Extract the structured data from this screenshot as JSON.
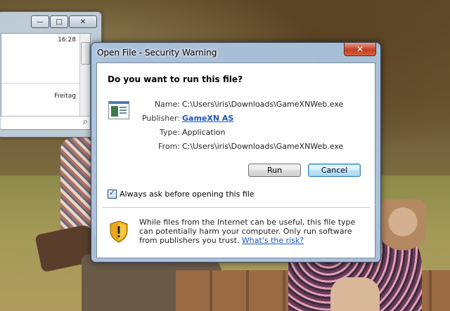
{
  "background_window": {
    "controls": [
      "—",
      "□",
      "✕"
    ],
    "rows": [
      {
        "time": "16:28"
      },
      {
        "time": "Freitag"
      }
    ]
  },
  "dialog": {
    "title": "Open File - Security Warning",
    "question": "Do you want to run this file?",
    "labels": {
      "name": "Name:",
      "publisher": "Publisher:",
      "type": "Type:",
      "from": "From:"
    },
    "values": {
      "name": "C:\\Users\\iris\\Downloads\\GameXNWeb.exe",
      "publisher": "GameXN AS",
      "type": "Application",
      "from": "C:\\Users\\iris\\Downloads\\GameXNWeb.exe"
    },
    "buttons": {
      "run": "Run",
      "cancel": "Cancel"
    },
    "checkbox": {
      "label": "Always ask before opening this file",
      "checked": true
    },
    "warning": {
      "text": "While files from the Internet can be useful, this file type can potentially harm your computer. Only run software from publishers you trust. ",
      "link": "What's the risk?"
    }
  }
}
